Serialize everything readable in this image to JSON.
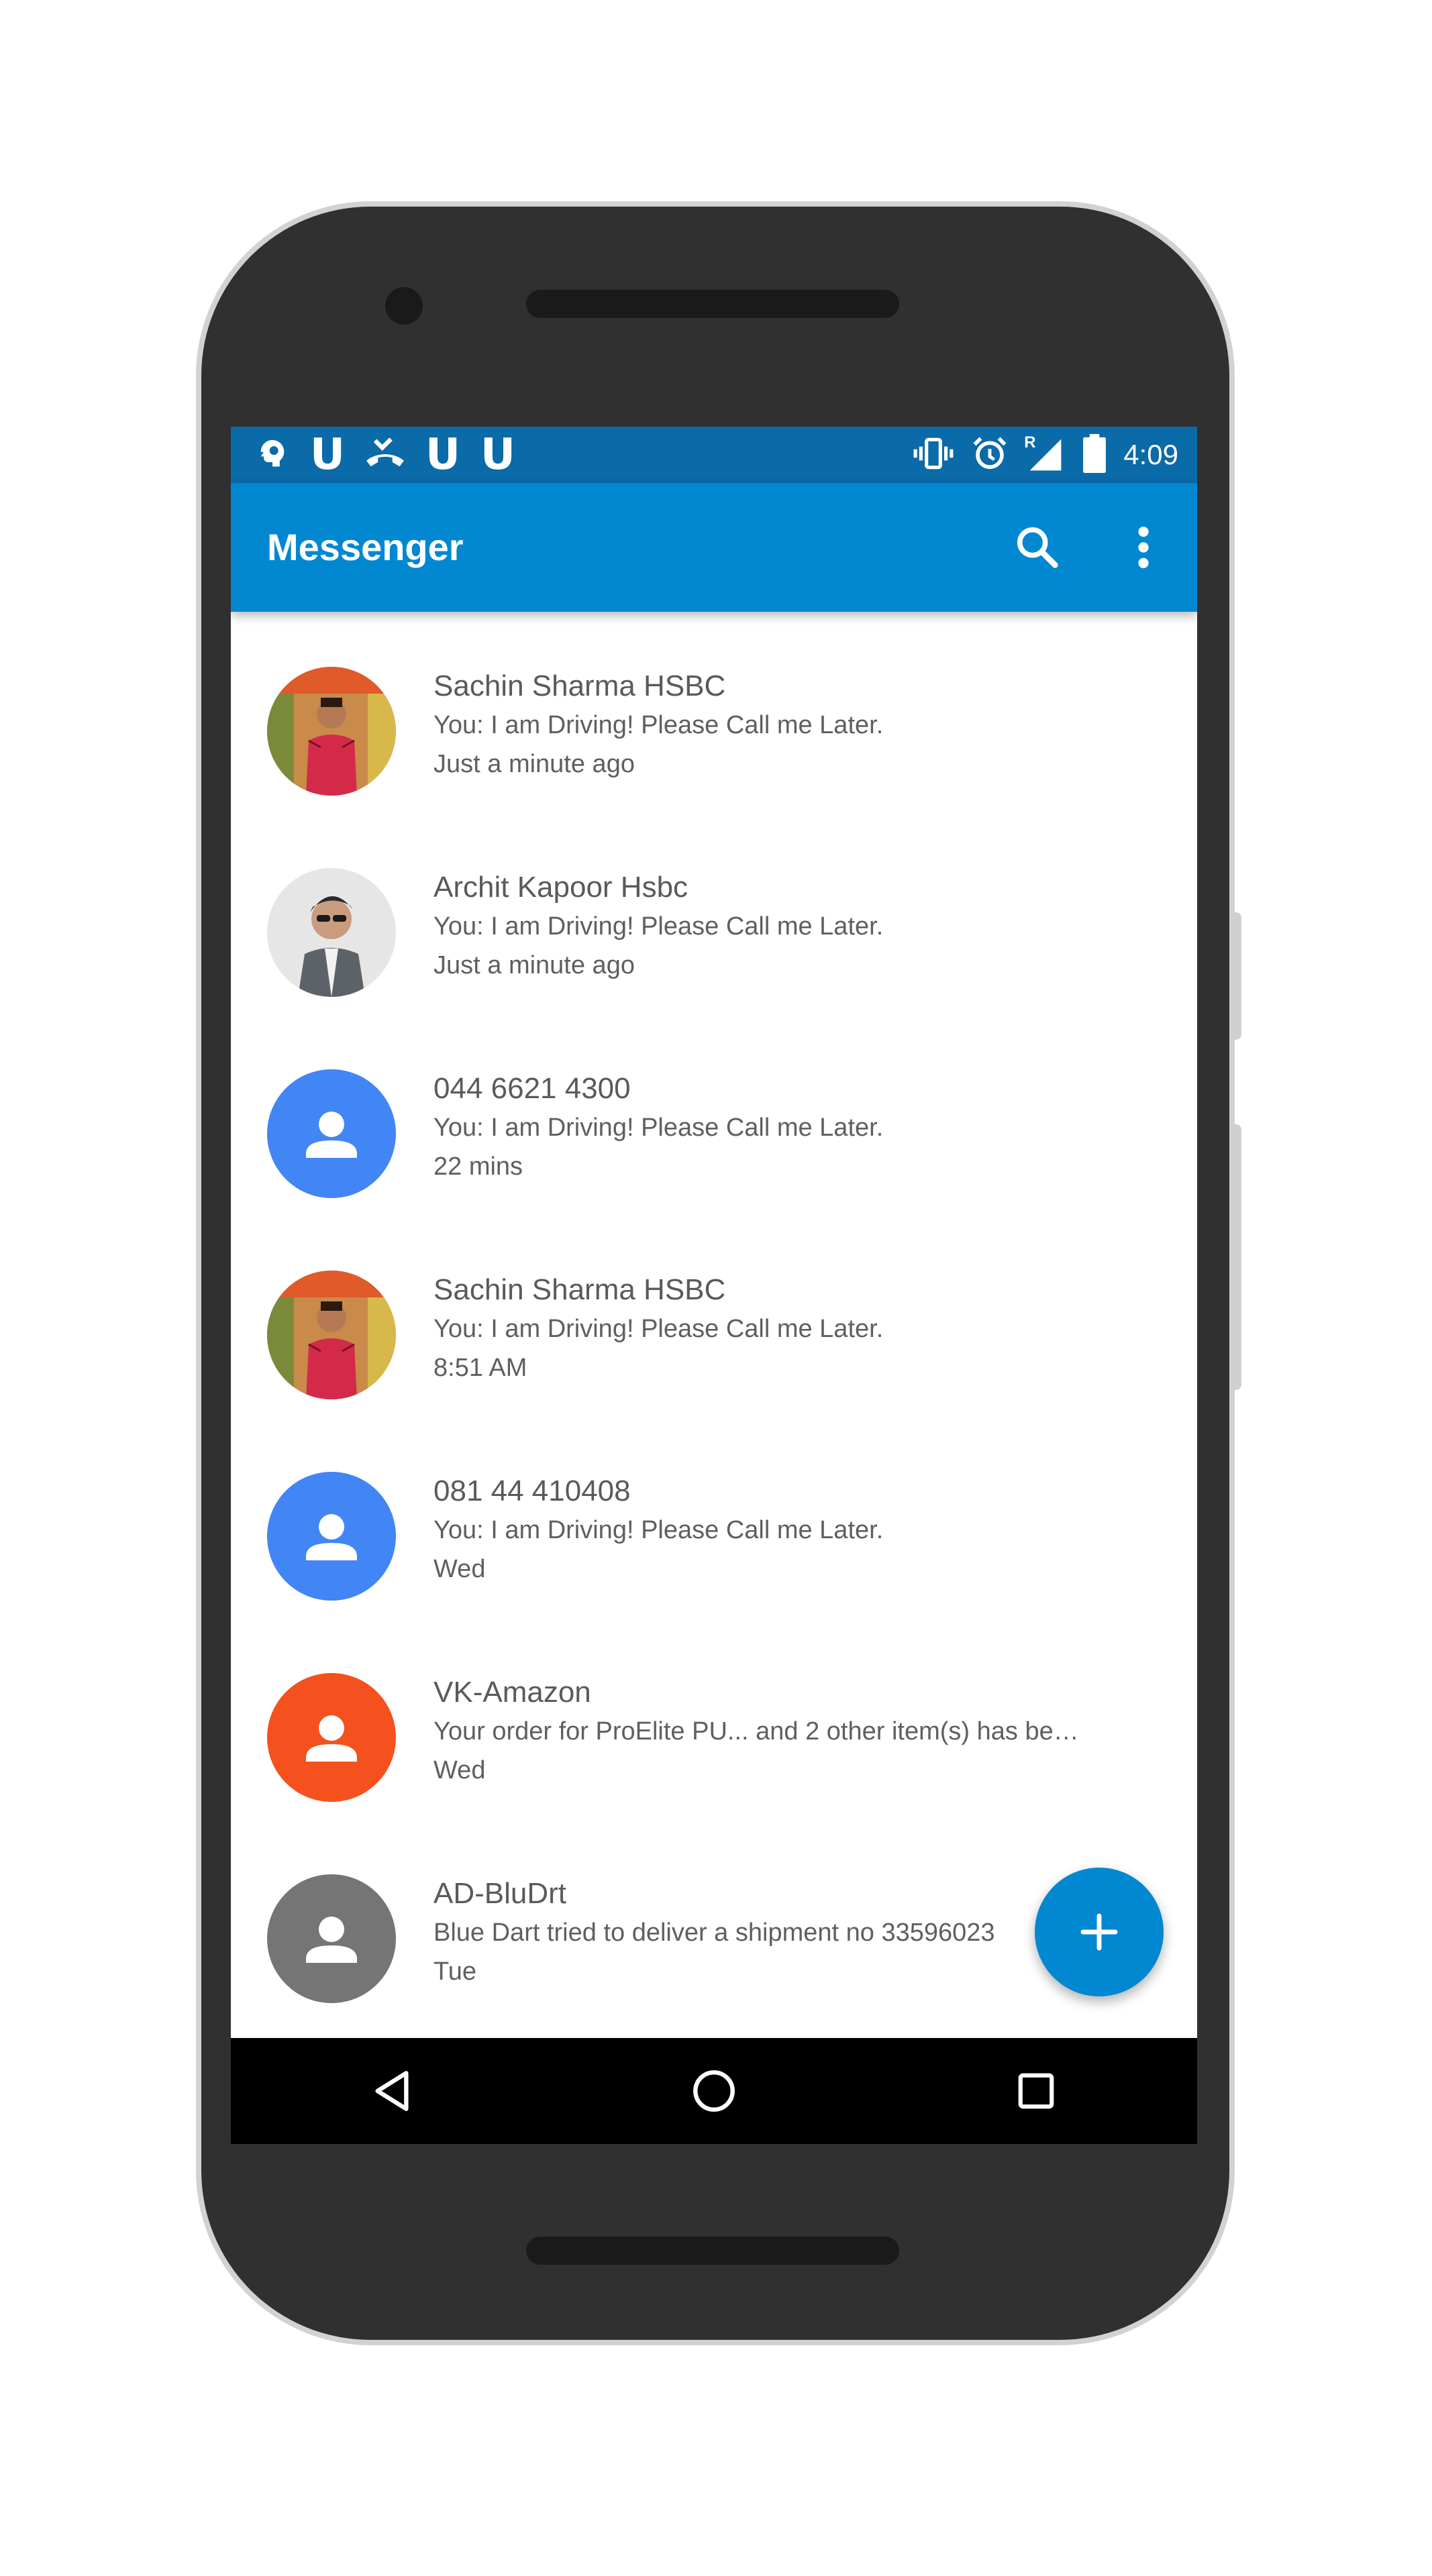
{
  "status_bar": {
    "left_icons": [
      "brain-notification-icon",
      "u-notification-icon",
      "missed-call-icon",
      "u-notification-icon",
      "u-notification-icon"
    ],
    "u_glyph": "U",
    "right_icons": [
      "vibrate-icon",
      "alarm-icon",
      "signal-roaming-icon",
      "battery-icon"
    ],
    "roaming_indicator": "R",
    "time": "4:09"
  },
  "app_bar": {
    "title": "Messenger",
    "actions": [
      "search-icon",
      "more-vert-icon"
    ]
  },
  "conversations": [
    {
      "name": "Sachin Sharma HSBC",
      "snippet": "You: I am Driving! Please Call me Later.",
      "time": "Just a minute ago",
      "avatar": "photo-red-shirt"
    },
    {
      "name": "Archit Kapoor Hsbc",
      "snippet": "You: I am Driving! Please Call me Later.",
      "time": "Just a minute ago",
      "avatar": "photo-sunglasses"
    },
    {
      "name": "044 6621 4300",
      "snippet": "You: I am Driving! Please Call me Later.",
      "time": "22 mins",
      "avatar": "person-icon",
      "avatar_color": "#4285f4"
    },
    {
      "name": "Sachin Sharma HSBC",
      "snippet": "You: I am Driving! Please Call me Later.",
      "time": "8:51 AM",
      "avatar": "photo-red-shirt"
    },
    {
      "name": "081 44 410408",
      "snippet": "You: I am Driving! Please Call me Later.",
      "time": "Wed",
      "avatar": "person-icon",
      "avatar_color": "#4285f4"
    },
    {
      "name": "VK-Amazon",
      "snippet": "Your order for ProElite PU... and 2 other item(s) has be…",
      "time": "Wed",
      "avatar": "person-icon",
      "avatar_color": "#f4511e"
    },
    {
      "name": "AD-BluDrt",
      "snippet": "Blue Dart tried to deliver a shipment no 33596023",
      "time": "Tue",
      "avatar": "person-icon",
      "avatar_color": "#757575"
    }
  ],
  "fab": {
    "icon": "plus-icon",
    "color": "#0288d1"
  },
  "nav_bar": {
    "buttons": [
      "back-icon",
      "home-icon",
      "recents-icon"
    ]
  },
  "colors": {
    "status_bar": "#0b6aa8",
    "app_bar": "#0288d1",
    "text_primary": "#5a5a5a",
    "phone_body": "#303030"
  }
}
